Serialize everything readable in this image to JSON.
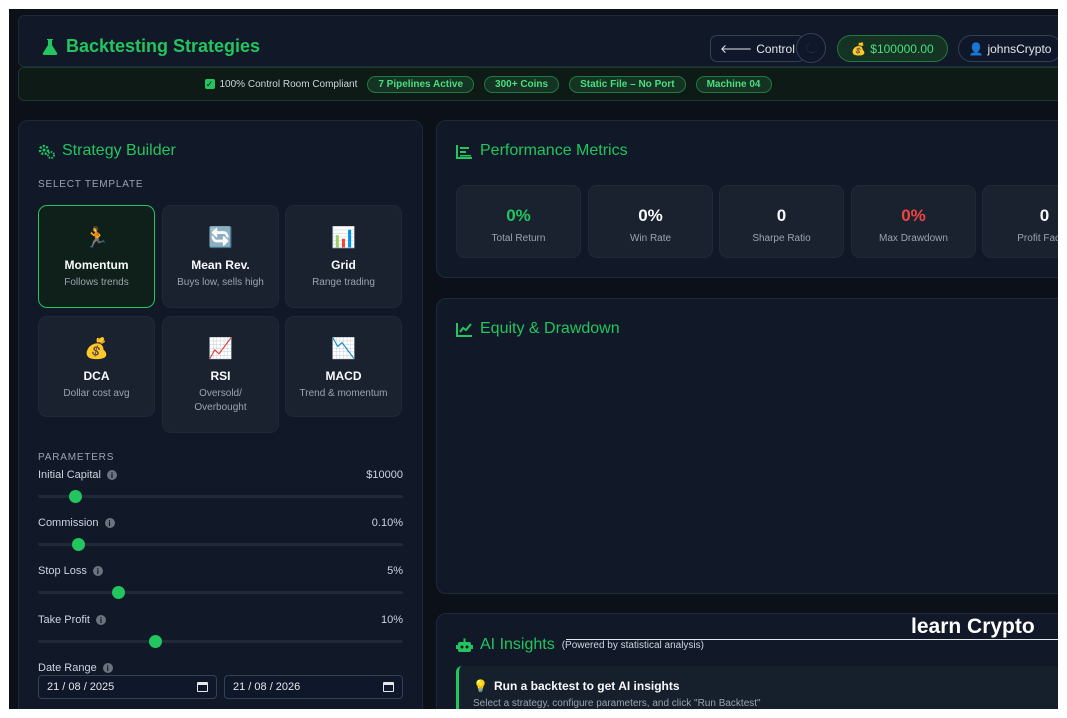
{
  "header": {
    "title": "Backtesting Strategies",
    "control_label": "Control",
    "balance": "$100000.00",
    "username": "johnsCrypto"
  },
  "status_bar": {
    "compliant": "100% Control Room Compliant",
    "pills": [
      "7 Pipelines Active",
      "300+ Coins",
      "Static File – No Port",
      "Machine 04"
    ]
  },
  "strategy_builder": {
    "title": "Strategy Builder",
    "template_label": "SELECT TEMPLATE",
    "templates": [
      {
        "name": "Momentum",
        "desc": "Follows trends",
        "emoji": "🏃",
        "active": true
      },
      {
        "name": "Mean Rev.",
        "desc": "Buys low, sells high",
        "emoji": "🔄",
        "active": false
      },
      {
        "name": "Grid",
        "desc": "Range trading",
        "emoji": "📊",
        "active": false
      },
      {
        "name": "DCA",
        "desc": "Dollar cost avg",
        "emoji": "💰",
        "active": false
      },
      {
        "name": "RSI",
        "desc": "Oversold/ Overbought",
        "emoji": "📈",
        "active": false
      },
      {
        "name": "MACD",
        "desc": "Trend & momentum",
        "emoji": "📉",
        "active": false
      }
    ],
    "parameters_label": "PARAMETERS",
    "params": [
      {
        "label": "Initial Capital",
        "value": "$10000",
        "level": 0.1
      },
      {
        "label": "Commission",
        "value": "0.10%",
        "level": 0.11
      },
      {
        "label": "Stop Loss",
        "value": "5%",
        "level": 0.22
      },
      {
        "label": "Take Profit",
        "value": "10%",
        "level": 0.32
      }
    ],
    "date_range_label": "Date Range",
    "date_start": "21 / 08 / 2025",
    "date_end": "21 / 08 / 2026"
  },
  "performance": {
    "title": "Performance Metrics",
    "metrics": [
      {
        "value": "0%",
        "label": "Total Return",
        "color": "#22c55e"
      },
      {
        "value": "0%",
        "label": "Win Rate",
        "color": "#f9fafb"
      },
      {
        "value": "0",
        "label": "Sharpe Ratio",
        "color": "#f9fafb"
      },
      {
        "value": "0%",
        "label": "Max Drawdown",
        "color": "#ef4444"
      },
      {
        "value": "0",
        "label": "Profit Factor",
        "color": "#f9fafb"
      }
    ]
  },
  "equity": {
    "title": "Equity & Drawdown"
  },
  "ai": {
    "title": "AI Insights",
    "subtitle": "(Powered by statistical analysis)",
    "card_title": "Run a backtest to get AI insights",
    "card_text": "Select a strategy, configure parameters, and click \"Run Backtest\""
  },
  "overlay": {
    "text": "learn Crypto"
  },
  "colors": {
    "accent": "#22c55e",
    "background": "#0b1019",
    "panel": "#111827",
    "danger": "#ef4444"
  }
}
